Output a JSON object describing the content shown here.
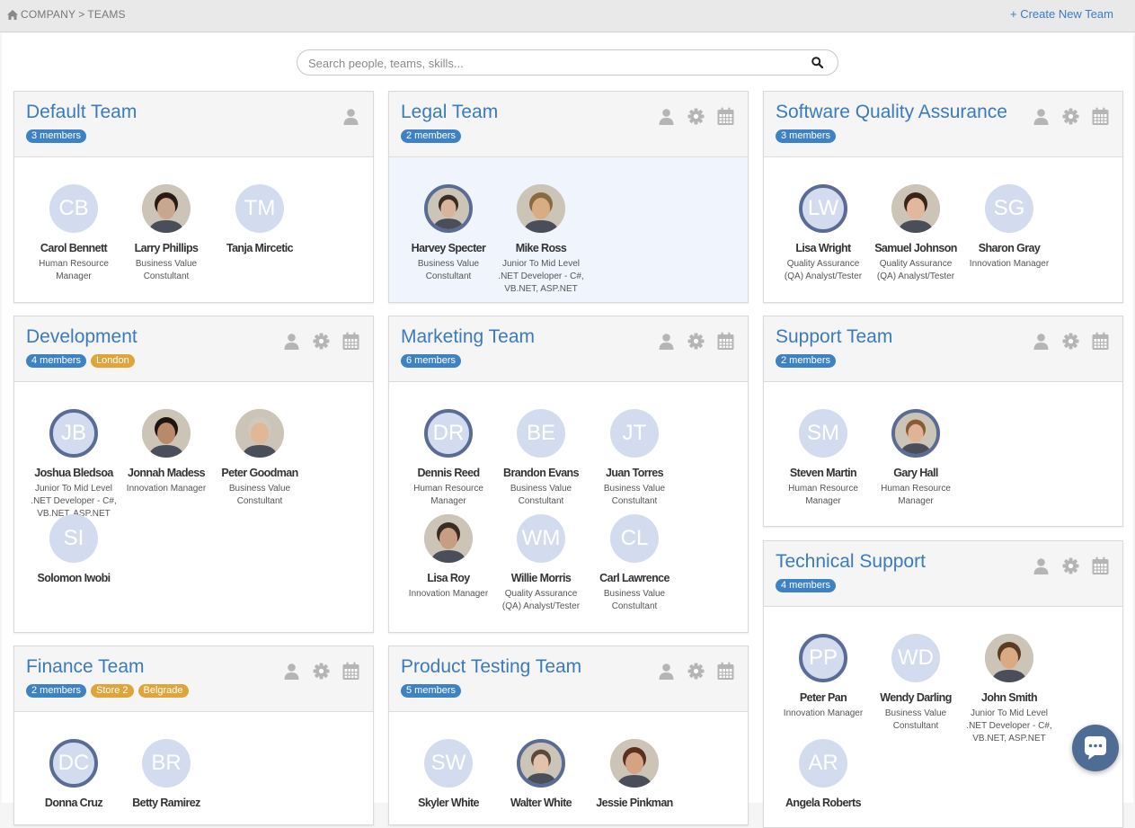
{
  "breadcrumb": [
    "COMPANY",
    "TEAMS"
  ],
  "create_team_label": "+ Create New Team",
  "search_placeholder": "Search people, teams, skills...",
  "teams": [
    {
      "name": "Default Team",
      "tags": [
        {
          "label": "3 members",
          "kind": "members"
        }
      ],
      "icons": [
        "person-icon"
      ],
      "highlight": false,
      "members": [
        {
          "name": "Carol Bennett",
          "role": "Human Resource Manager",
          "initials": "CB",
          "avatar": "initials"
        },
        {
          "name": "Larry Phillips",
          "role": "Business Value Constultant",
          "initials": "",
          "avatar": "photo",
          "skin": "#c9a68e",
          "hair": "#2a1a14"
        },
        {
          "name": "Tanja Mircetic",
          "role": "",
          "initials": "TM",
          "avatar": "initials"
        }
      ]
    },
    {
      "name": "Legal Team",
      "tags": [
        {
          "label": "2 members",
          "kind": "members"
        }
      ],
      "icons": [
        "person-icon",
        "gear-icon",
        "calendar-icon"
      ],
      "highlight": true,
      "members": [
        {
          "name": "Harvey Specter",
          "role": "Business Value Constultant",
          "initials": "",
          "avatar": "photo-ring",
          "skin": "#d7b49c",
          "hair": "#3b2d25"
        },
        {
          "name": "Mike Ross",
          "role": "Junior To Mid Level .NET Developer - C#, VB.NET, ASP.NET",
          "initials": "",
          "avatar": "photo",
          "skin": "#d9ad84",
          "hair": "#8a6a42"
        }
      ]
    },
    {
      "name": "Software Quality Assurance",
      "tags": [
        {
          "label": "3 members",
          "kind": "members"
        }
      ],
      "icons": [
        "person-icon",
        "gear-icon",
        "calendar-icon"
      ],
      "highlight": false,
      "members": [
        {
          "name": "Lisa Wright",
          "role": "Quality Assurance (QA) Analyst/Tester",
          "initials": "LW",
          "avatar": "initials-ring"
        },
        {
          "name": "Samuel Johnson",
          "role": "Quality Assurance (QA) Analyst/Tester",
          "initials": "",
          "avatar": "photo",
          "skin": "#e2b89c",
          "hair": "#3a2418"
        },
        {
          "name": "Sharon Gray",
          "role": "Innovation Manager",
          "initials": "SG",
          "avatar": "initials"
        }
      ]
    },
    {
      "name": "Development",
      "tags": [
        {
          "label": "4 members",
          "kind": "members"
        },
        {
          "label": "London",
          "kind": "location"
        }
      ],
      "icons": [
        "person-icon",
        "gear-icon",
        "calendar-icon"
      ],
      "highlight": false,
      "members": [
        {
          "name": "Joshua Bledsoa",
          "role": "Junior To Mid Level .NET Developer - C#, VB.NET, ASP.NET",
          "initials": "JB",
          "avatar": "initials-ring"
        },
        {
          "name": "Jonnah Madess",
          "role": "Innovation Manager",
          "initials": "",
          "avatar": "photo",
          "skin": "#b98a6a",
          "hair": "#1f140e"
        },
        {
          "name": "Peter Goodman",
          "role": "Business Value Constultant",
          "initials": "",
          "avatar": "photo",
          "skin": "#e0b898",
          "hair": "#cfc8bd"
        },
        {
          "name": "Solomon Iwobi",
          "role": "",
          "initials": "SI",
          "avatar": "initials"
        }
      ]
    },
    {
      "name": "Marketing Team",
      "tags": [
        {
          "label": "6 members",
          "kind": "members"
        }
      ],
      "icons": [
        "person-icon",
        "gear-icon",
        "calendar-icon"
      ],
      "highlight": false,
      "members": [
        {
          "name": "Dennis Reed",
          "role": "Human Resource Manager",
          "initials": "DR",
          "avatar": "initials-ring"
        },
        {
          "name": "Brandon Evans",
          "role": "Business Value Constultant",
          "initials": "BE",
          "avatar": "initials"
        },
        {
          "name": "Juan Torres",
          "role": "Business Value Constultant",
          "initials": "JT",
          "avatar": "initials"
        },
        {
          "name": "Lisa Roy",
          "role": "Innovation Manager",
          "initials": "",
          "avatar": "photo",
          "skin": "#c79e82",
          "hair": "#3a2c22"
        },
        {
          "name": "Willie Morris",
          "role": "Quality Assurance (QA) Analyst/Tester",
          "initials": "WM",
          "avatar": "initials"
        },
        {
          "name": "Carl Lawrence",
          "role": "Business Value Constultant",
          "initials": "CL",
          "avatar": "initials"
        }
      ]
    },
    {
      "name": "Support Team",
      "tags": [
        {
          "label": "2 members",
          "kind": "members"
        }
      ],
      "icons": [
        "person-icon",
        "gear-icon",
        "calendar-icon"
      ],
      "highlight": false,
      "members": [
        {
          "name": "Steven Martin",
          "role": "Human Resource Manager",
          "initials": "SM",
          "avatar": "initials"
        },
        {
          "name": "Gary Hall",
          "role": "Human Resource Manager",
          "initials": "",
          "avatar": "photo-ring",
          "skin": "#e0b394",
          "hair": "#8a5a34"
        }
      ]
    },
    {
      "name": "Finance Team",
      "tags": [
        {
          "label": "2 members",
          "kind": "members"
        },
        {
          "label": "Store 2",
          "kind": "location"
        },
        {
          "label": "Belgrade",
          "kind": "location"
        }
      ],
      "icons": [
        "person-icon",
        "gear-icon",
        "calendar-icon"
      ],
      "highlight": false,
      "members": [
        {
          "name": "Donna Cruz",
          "role": "",
          "initials": "DC",
          "avatar": "initials-ring"
        },
        {
          "name": "Betty Ramirez",
          "role": "",
          "initials": "BR",
          "avatar": "initials"
        }
      ]
    },
    {
      "name": "Product Testing Team",
      "tags": [
        {
          "label": "5 members",
          "kind": "members"
        }
      ],
      "icons": [
        "person-icon",
        "gear-icon",
        "calendar-icon"
      ],
      "highlight": false,
      "members": [
        {
          "name": "Skyler White",
          "role": "",
          "initials": "SW",
          "avatar": "initials"
        },
        {
          "name": "Walter White",
          "role": "",
          "initials": "",
          "avatar": "photo-ring",
          "skin": "#e2c2aa",
          "hair": "#5a4a3c"
        },
        {
          "name": "Jessie Pinkman",
          "role": "",
          "initials": "",
          "avatar": "photo",
          "skin": "#d4a385",
          "hair": "#5a2f1e"
        }
      ]
    },
    {
      "name": "Technical Support",
      "tags": [
        {
          "label": "4 members",
          "kind": "members"
        }
      ],
      "icons": [
        "person-icon",
        "gear-icon",
        "calendar-icon"
      ],
      "highlight": false,
      "members": [
        {
          "name": "Peter Pan",
          "role": "Innovation Manager",
          "initials": "PP",
          "avatar": "initials-ring"
        },
        {
          "name": "Wendy Darling",
          "role": "Business Value Constultant",
          "initials": "WD",
          "avatar": "initials"
        },
        {
          "name": "John Smith",
          "role": "Junior To Mid Level .NET Developer - C#, VB.NET, ASP.NET",
          "initials": "",
          "avatar": "photo",
          "skin": "#d9aa84",
          "hair": "#5b3c22"
        },
        {
          "name": "Angela Roberts",
          "role": "",
          "initials": "AR",
          "avatar": "initials"
        }
      ]
    }
  ],
  "colors": {
    "accent": "#3a7bbf",
    "members_badge": "#3d82c4",
    "location_badge": "#e0a43a",
    "avatar_bg": "#d3dcef",
    "avatar_ring": "#5a6c95",
    "chat_button": "#4f6d94"
  }
}
